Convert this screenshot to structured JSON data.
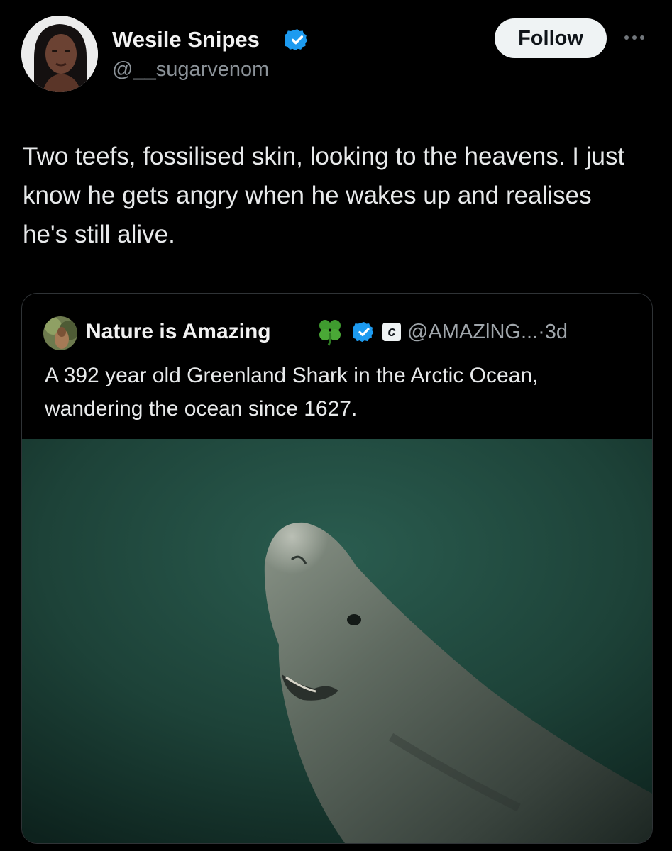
{
  "author": {
    "display_name": "Wesile Snipes",
    "handle": "@__sugarvenom"
  },
  "follow_button": {
    "label": "Follow"
  },
  "tweet": {
    "text": "Two teefs, fossilised skin, looking to the heavens. I just know he gets angry when he wakes up and realises he's still alive."
  },
  "quoted_tweet": {
    "display_name": "Nature is Amazing",
    "handle": "@AMAZlNG...",
    "separator": "·",
    "time_ago": "3d",
    "text": "A 392 year old Greenland Shark in the Arctic Ocean, wandering the ocean since 1627."
  },
  "colors": {
    "background": "#000000",
    "verified_blue": "#1d9bf0",
    "follow_button_bg": "#eff3f4",
    "muted_text": "#71767b",
    "clover_green": "#3f9b2f",
    "water_teal": "#1f4a40"
  },
  "icons": {
    "verified": "verified-badge-icon",
    "more": "more-dots-icon",
    "clover": "four-leaf-clover-icon",
    "affiliate_badge": "c-badge-icon"
  }
}
